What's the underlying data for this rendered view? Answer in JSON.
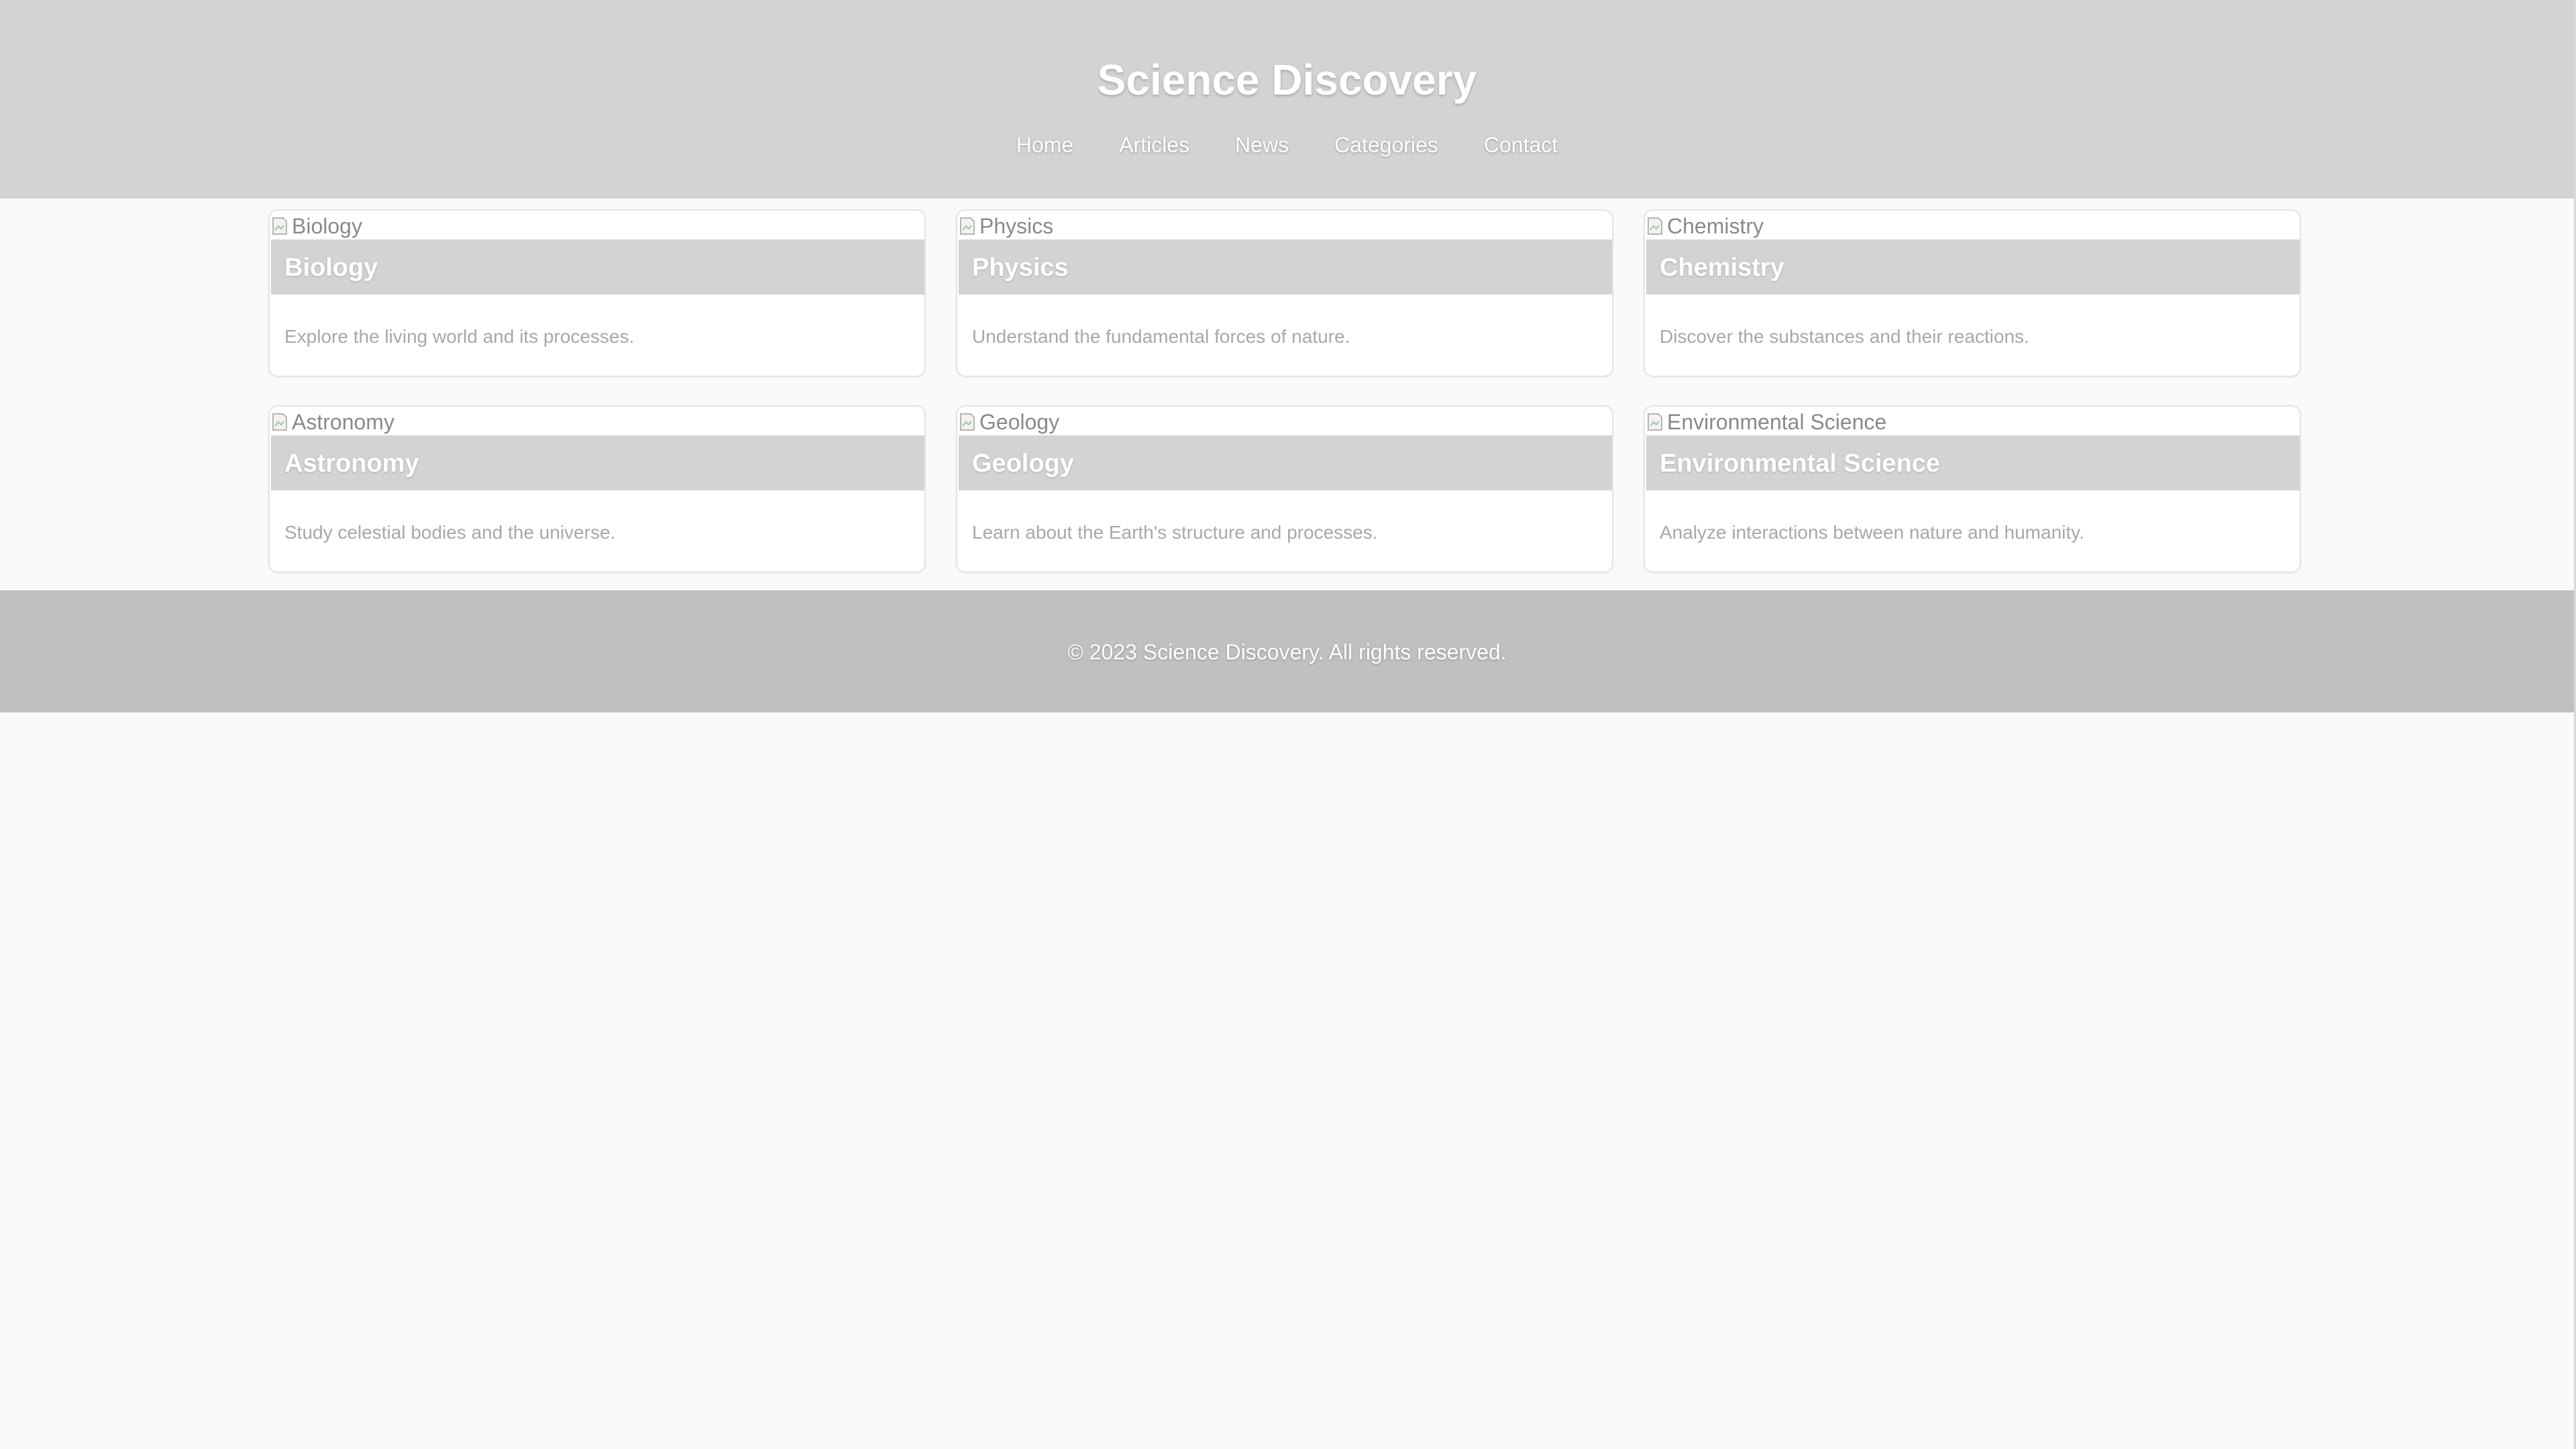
{
  "header": {
    "title": "Science Discovery",
    "background": "#d3d3d3"
  },
  "nav": {
    "items": [
      {
        "label": "Home"
      },
      {
        "label": "Articles"
      },
      {
        "label": "News"
      },
      {
        "label": "Categories"
      },
      {
        "label": "Contact"
      }
    ]
  },
  "cards": [
    {
      "image_alt": "Biology",
      "title": "Biology",
      "description": "Explore the living world and its processes."
    },
    {
      "image_alt": "Physics",
      "title": "Physics",
      "description": "Understand the fundamental forces of nature."
    },
    {
      "image_alt": "Chemistry",
      "title": "Chemistry",
      "description": "Discover the substances and their reactions."
    },
    {
      "image_alt": "Astronomy",
      "title": "Astronomy",
      "description": "Study celestial bodies and the universe."
    },
    {
      "image_alt": "Geology",
      "title": "Geology",
      "description": "Learn about the Earth's structure and processes."
    },
    {
      "image_alt": "Environmental Science",
      "title": "Environmental Science",
      "description": "Analyze interactions between nature and humanity."
    }
  ],
  "footer": {
    "text": "© 2023 Science Discovery. All rights reserved.",
    "background": "#c0c0c0"
  },
  "icons": {
    "broken_image": "broken-image-icon"
  }
}
